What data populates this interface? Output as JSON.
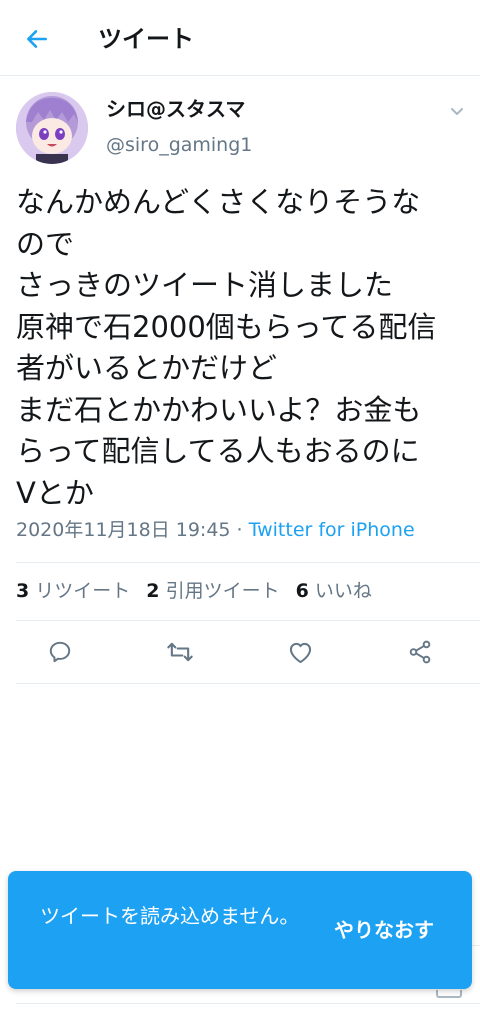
{
  "header": {
    "title": "ツイート"
  },
  "tweet": {
    "display_name": "シロ@スタスマ",
    "handle": "@siro_gaming1",
    "lines": [
      "なんかめんどくさくなりそうな",
      "ので",
      "さっきのツイート消しました",
      "原神で石2000個もらってる配信",
      "者がいるとかだけど",
      "まだ石とかかわいいよ？お金も",
      "らって配信してる人もおるのに",
      "Vとか"
    ],
    "date": "2020年11月18日 19:45",
    "separator": " · ",
    "source": "Twitter for iPhone"
  },
  "stats": {
    "retweets": {
      "count": "3",
      "label": "リツイート"
    },
    "quotes": {
      "count": "2",
      "label": "引用ツイート"
    },
    "likes": {
      "count": "6",
      "label": "いいね"
    }
  },
  "toast": {
    "message": "ツイートを読み込めません。",
    "retry_label": "やりなおす"
  },
  "icons": {
    "back": "arrow-left-icon",
    "caret": "chevron-down-icon",
    "reply": "reply-icon",
    "retweet": "retweet-icon",
    "like": "heart-icon",
    "share": "share-icon"
  },
  "colors": {
    "accent": "#1da1f2",
    "text": "#14171a",
    "secondary": "#657786",
    "divider": "#e6ecf0"
  }
}
